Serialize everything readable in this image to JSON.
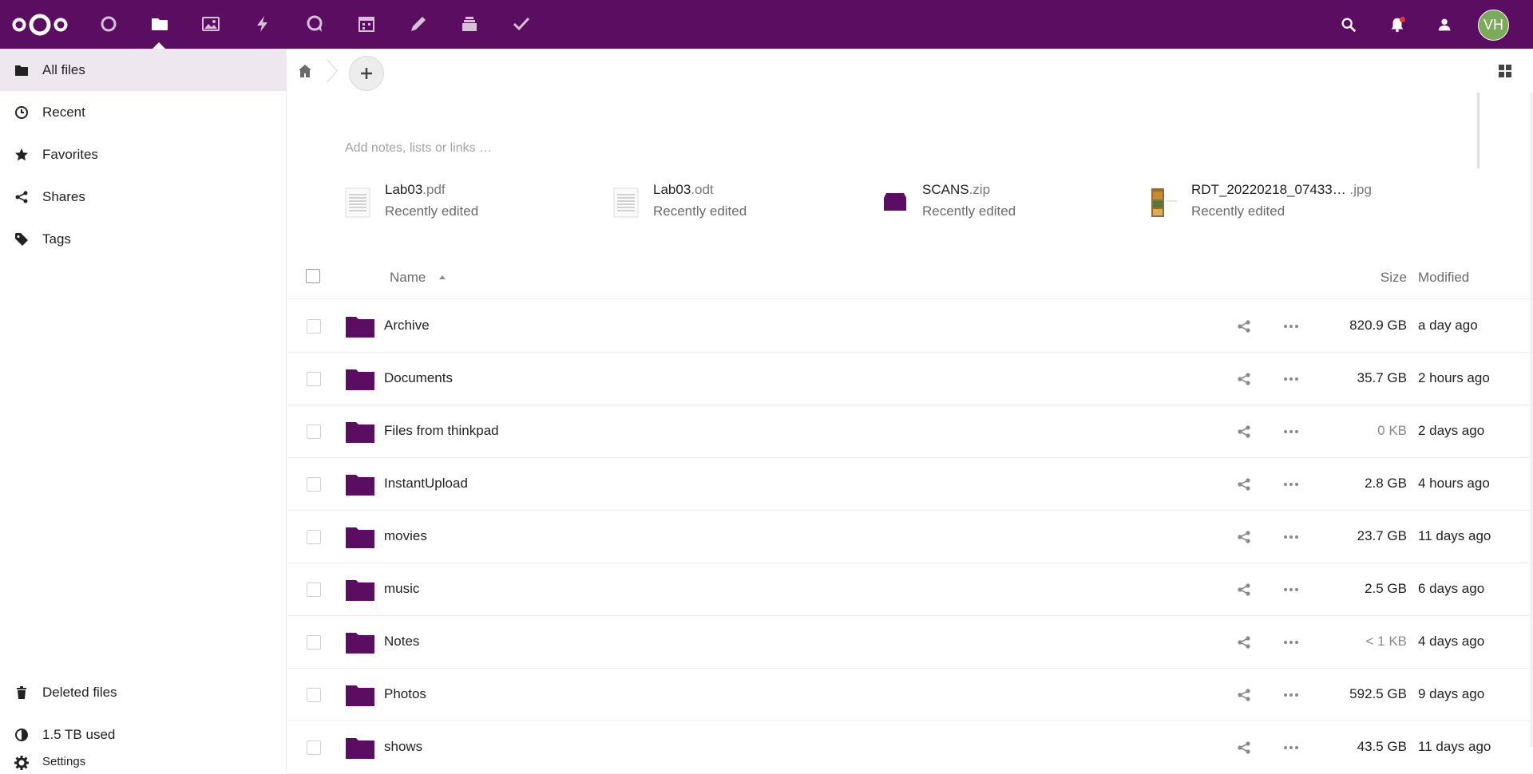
{
  "header": {
    "avatar_initials": "VH",
    "apps": [
      {
        "icon": "dashboard-icon"
      },
      {
        "icon": "files-icon"
      },
      {
        "icon": "photos-icon"
      },
      {
        "icon": "activity-icon"
      },
      {
        "icon": "talk-icon"
      },
      {
        "icon": "calendar-icon"
      },
      {
        "icon": "notes-pencil-icon"
      },
      {
        "icon": "deck-icon"
      },
      {
        "icon": "tasks-icon"
      }
    ]
  },
  "sidebar": {
    "items": [
      {
        "label": "All files",
        "icon": "folder-icon"
      },
      {
        "label": "Recent",
        "icon": "clock-icon"
      },
      {
        "label": "Favorites",
        "icon": "star-icon"
      },
      {
        "label": "Shares",
        "icon": "share-icon"
      },
      {
        "label": "Tags",
        "icon": "tag-icon"
      }
    ],
    "bottom": [
      {
        "label": "Deleted files",
        "icon": "trash-icon"
      },
      {
        "label": "1.5 TB used",
        "icon": "quota-pie-icon"
      },
      {
        "label": "Settings",
        "icon": "gear-icon"
      }
    ]
  },
  "main": {
    "notes_placeholder": "Add notes, lists or links …",
    "recent": [
      {
        "name": "Lab03",
        "ext": ".pdf",
        "sub": "Recently edited"
      },
      {
        "name": "Lab03",
        "ext": ".odt",
        "sub": "Recently edited"
      },
      {
        "name": "SCANS",
        "ext": ".zip",
        "sub": "Recently edited"
      },
      {
        "name": "RDT_20220218_07433…",
        "ext": " .jpg",
        "sub": "Recently edited"
      }
    ],
    "table": {
      "col_name": "Name",
      "col_size": "Size",
      "col_modified": "Modified",
      "rows": [
        {
          "name": "Archive",
          "size": "820.9 GB",
          "modified": "a day ago"
        },
        {
          "name": "Documents",
          "size": "35.7 GB",
          "modified": "2 hours ago"
        },
        {
          "name": "Files from thinkpad",
          "size": "0 KB",
          "modified": "2 days ago"
        },
        {
          "name": "InstantUpload",
          "size": "2.8 GB",
          "modified": "4 hours ago"
        },
        {
          "name": "movies",
          "size": "23.7 GB",
          "modified": "11 days ago"
        },
        {
          "name": "music",
          "size": "2.5 GB",
          "modified": "6 days ago"
        },
        {
          "name": "Notes",
          "size": "< 1 KB",
          "modified": "4 days ago"
        },
        {
          "name": "Photos",
          "size": "592.5 GB",
          "modified": "9 days ago"
        },
        {
          "name": "shows",
          "size": "43.5 GB",
          "modified": "11 days ago"
        }
      ]
    }
  },
  "colors": {
    "brand": "#5b0e61",
    "avatar": "#7bab5a"
  }
}
